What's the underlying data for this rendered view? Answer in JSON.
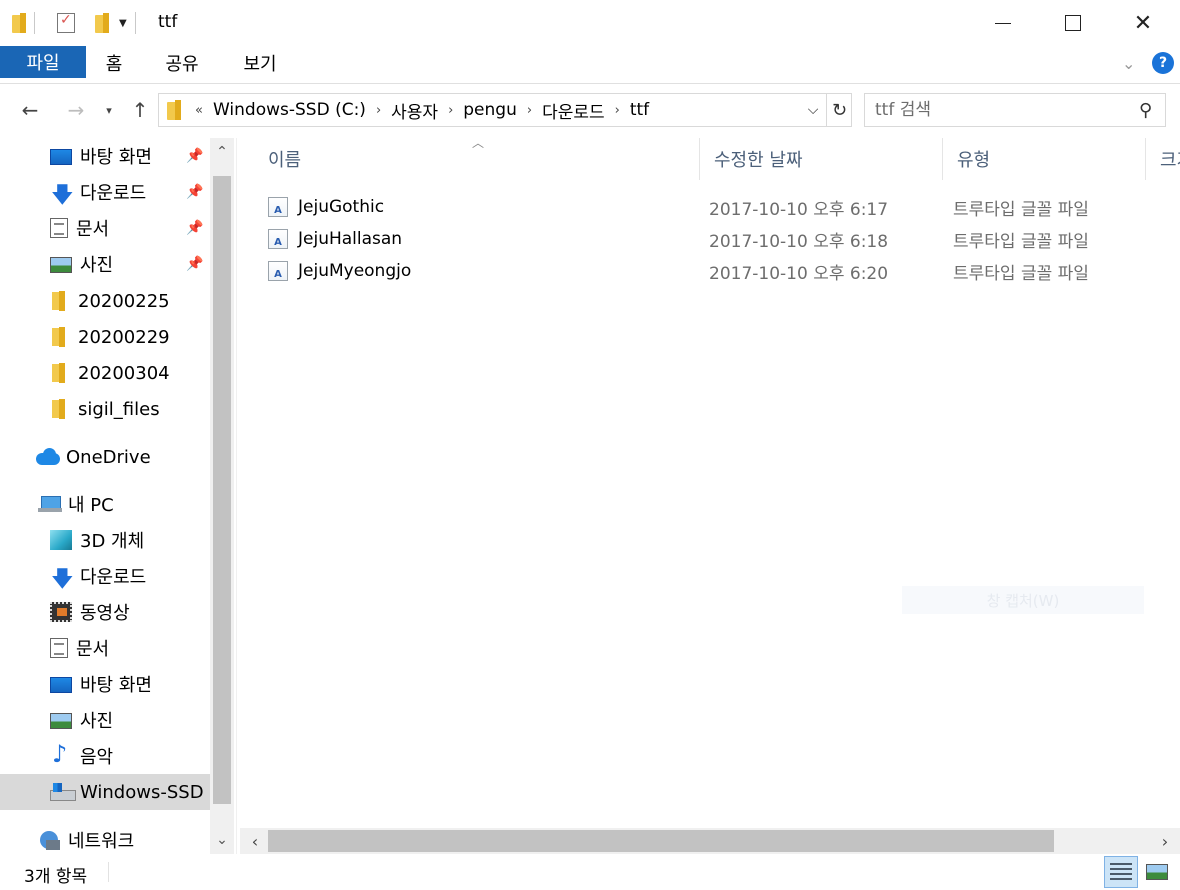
{
  "window": {
    "title": "ttf",
    "minimize_icon": "minimize-icon",
    "maximize_icon": "maximize-icon",
    "close_icon": "close-icon",
    "close_glyph": "✕"
  },
  "ribbon": {
    "tabs": [
      {
        "label": "파일",
        "active": true
      },
      {
        "label": "홈"
      },
      {
        "label": "공유"
      },
      {
        "label": "보기"
      }
    ],
    "help_glyph": "?",
    "accent": "#1a66b5"
  },
  "address": {
    "overflow": "«",
    "crumbs": [
      "Windows-SSD (C:)",
      "사용자",
      "pengu",
      "다운로드",
      "ttf"
    ],
    "separator": "›"
  },
  "search": {
    "placeholder": "ttf 검색"
  },
  "nav": {
    "quick_access": [
      {
        "label": "바탕 화면",
        "icon": "desktop-icon",
        "pinned": true
      },
      {
        "label": "다운로드",
        "icon": "download-icon",
        "pinned": true
      },
      {
        "label": "문서",
        "icon": "documents-icon",
        "pinned": true
      },
      {
        "label": "사진",
        "icon": "pictures-icon",
        "pinned": true
      },
      {
        "label": "20200225",
        "icon": "folder-icon"
      },
      {
        "label": "20200229",
        "icon": "folder-icon"
      },
      {
        "label": "20200304",
        "icon": "folder-icon"
      },
      {
        "label": "sigil_files",
        "icon": "folder-icon"
      }
    ],
    "onedrive": {
      "label": "OneDrive",
      "icon": "onedrive-icon"
    },
    "this_pc": {
      "label": "내 PC",
      "icon": "computer-icon"
    },
    "pc_items": [
      {
        "label": "3D 개체",
        "icon": "3d-objects-icon"
      },
      {
        "label": "다운로드",
        "icon": "download-icon"
      },
      {
        "label": "동영상",
        "icon": "videos-icon"
      },
      {
        "label": "문서",
        "icon": "documents-icon"
      },
      {
        "label": "바탕 화면",
        "icon": "desktop-icon"
      },
      {
        "label": "사진",
        "icon": "pictures-icon"
      },
      {
        "label": "음악",
        "icon": "music-icon"
      },
      {
        "label": "Windows-SSD (C:)",
        "icon": "drive-icon",
        "selected": true
      }
    ],
    "network": {
      "label": "네트워크",
      "icon": "network-icon"
    }
  },
  "list": {
    "columns": [
      "이름",
      "수정한 날짜",
      "유형",
      "크기"
    ],
    "files": [
      {
        "name": "JejuGothic",
        "modified": "2017-10-10 오후 6:17",
        "type": "트루타입 글꼴 파일"
      },
      {
        "name": "JejuHallasan",
        "modified": "2017-10-10 오후 6:18",
        "type": "트루타입 글꼴 파일"
      },
      {
        "name": "JejuMyeongjo",
        "modified": "2017-10-10 오후 6:20",
        "type": "트루타입 글꼴 파일"
      }
    ],
    "file_icon": "font-file-icon",
    "file_icon_glyph": "A"
  },
  "watermark": "창 캡처(W)",
  "status": {
    "item_count": "3개 항목"
  }
}
